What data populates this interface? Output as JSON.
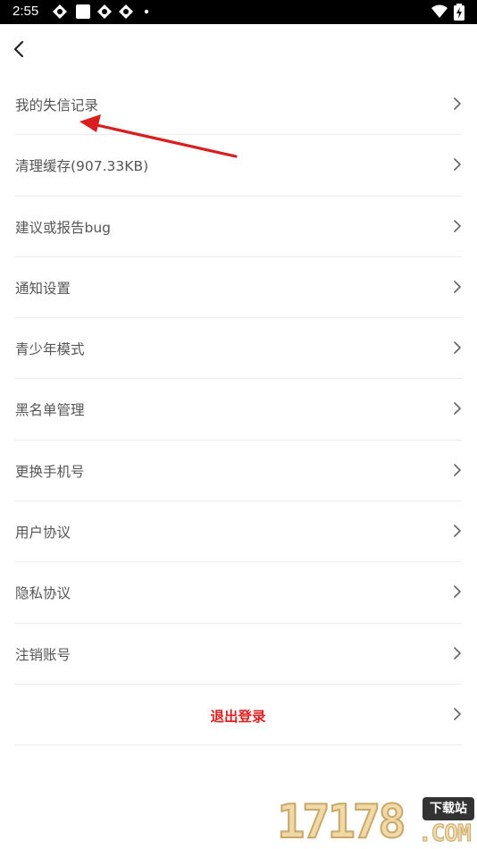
{
  "status_bar": {
    "time": "2:55",
    "icons": [
      "notification-icon",
      "square-icon",
      "notification-icon",
      "notification-icon",
      "dot-icon",
      "wifi-icon",
      "battery-charging-icon"
    ]
  },
  "nav": {
    "back_icon": "chevron-left-icon"
  },
  "settings": {
    "items": [
      {
        "label": "我的失信记录"
      },
      {
        "label": "清理缓存(907.33KB)"
      },
      {
        "label": "建议或报告bug"
      },
      {
        "label": "通知设置"
      },
      {
        "label": "青少年模式"
      },
      {
        "label": "黑名单管理"
      },
      {
        "label": "更换手机号"
      },
      {
        "label": "用户协议"
      },
      {
        "label": "隐私协议"
      },
      {
        "label": "注销账号"
      }
    ],
    "logout_label": "退出登录"
  },
  "annotation": {
    "color": "#d81e1e"
  },
  "watermark": {
    "digits": "17178",
    "badge": "下载站",
    "suffix": ".COM"
  },
  "colors": {
    "logout": "#e02020",
    "divider": "#ececec",
    "label": "#555555"
  }
}
